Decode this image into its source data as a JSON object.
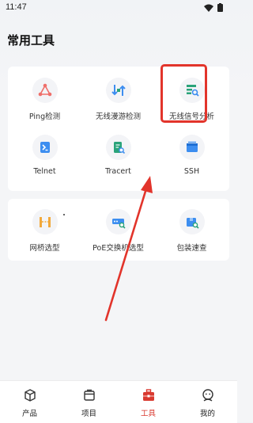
{
  "status_bar": {
    "time": "11:47"
  },
  "page": {
    "title": "常用工具"
  },
  "tools_group1": [
    {
      "label": "Ping检测",
      "icon": "ping-icon"
    },
    {
      "label": "无线漫游检测",
      "icon": "roaming-icon"
    },
    {
      "label": "无线信号分析",
      "icon": "signal-analysis-icon"
    },
    {
      "label": "Telnet",
      "icon": "telnet-icon"
    },
    {
      "label": "Tracert",
      "icon": "tracert-icon"
    },
    {
      "label": "SSH",
      "icon": "ssh-icon"
    }
  ],
  "tools_group2": [
    {
      "label": "网桥选型",
      "icon": "bridge-icon"
    },
    {
      "label": "PoE交换机选型",
      "icon": "poe-switch-icon"
    },
    {
      "label": "包装速查",
      "icon": "package-lookup-icon"
    }
  ],
  "bottom_nav": [
    {
      "label": "产品",
      "icon": "cube-icon",
      "active": false
    },
    {
      "label": "项目",
      "icon": "folder-icon",
      "active": false
    },
    {
      "label": "工具",
      "icon": "toolbox-icon",
      "active": true
    },
    {
      "label": "我的",
      "icon": "profile-icon",
      "active": false
    }
  ],
  "colors": {
    "accent_red": "#d93a30",
    "annotation_red": "#e2342b",
    "icon_blue": "#3d8ef0",
    "icon_green": "#2aa37a",
    "icon_orange": "#f2a93b",
    "icon_pink": "#ef6f6a"
  }
}
